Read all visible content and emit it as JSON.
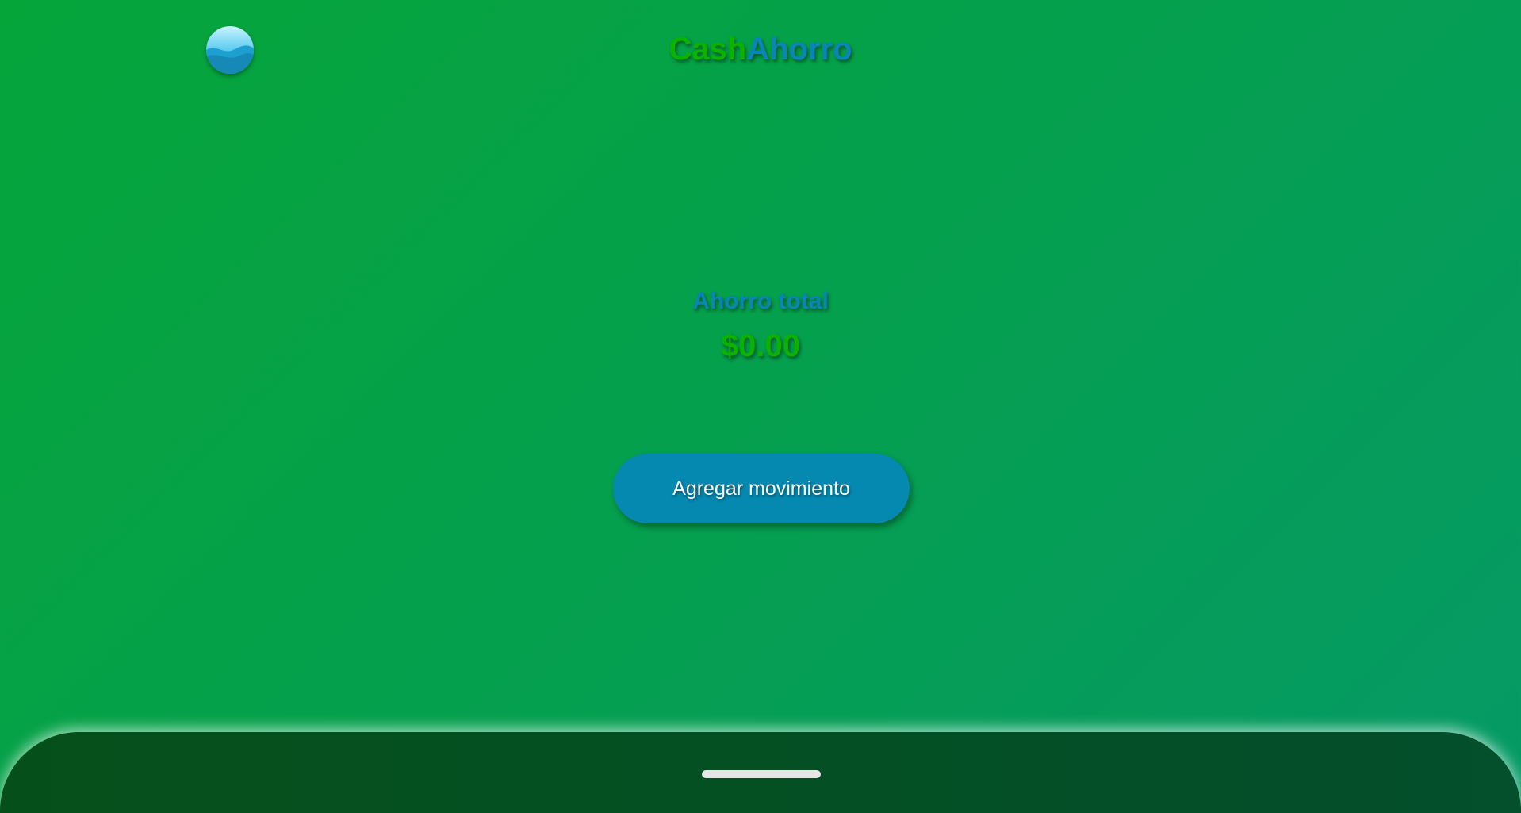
{
  "header": {
    "logo_icon": "ocean-wave-icon",
    "title_part1": "Cash",
    "title_part2": "Ahorro",
    "title_colors": {
      "part1": "#0bb300",
      "part2": "#0a85b8"
    }
  },
  "main": {
    "total_label": "Ahorro total",
    "total_amount": "$0.00",
    "add_button_label": "Agregar movimiento"
  },
  "colors": {
    "background_start": "#06a53a",
    "background_end": "#059a66",
    "button": "#0589b0",
    "bottom_bar": "#05501a",
    "home_indicator": "#e6e6e6"
  }
}
